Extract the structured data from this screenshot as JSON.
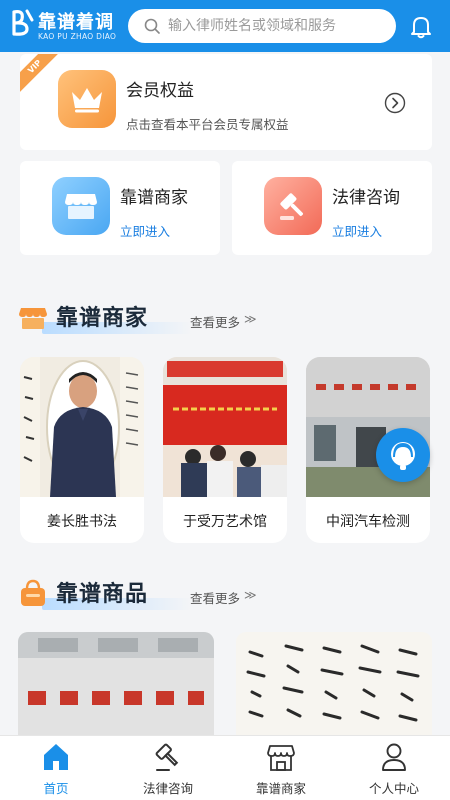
{
  "header": {
    "logo_cn": "靠谱着调",
    "logo_en": "KAO PU ZHAO DIAO",
    "search_placeholder": "输入律师姓名或领域和服务",
    "bell_icon": "bell-icon"
  },
  "member": {
    "ribbon": "VIP",
    "title": "会员权益",
    "subtitle": "点击查看本平台会员专属权益"
  },
  "services": [
    {
      "title": "靠谱商家",
      "link": "立即进入",
      "icon": "store-icon"
    },
    {
      "title": "法律咨询",
      "link": "立即进入",
      "icon": "gavel-icon"
    }
  ],
  "sections": {
    "merchants": {
      "title": "靠谱商家",
      "more": "查看更多"
    },
    "products": {
      "title": "靠谱商品",
      "more": "查看更多"
    }
  },
  "merchants": [
    {
      "name": "姜长胜书法"
    },
    {
      "name": "于受万艺术馆"
    },
    {
      "name": "中润汽车检测"
    }
  ],
  "tabbar": [
    {
      "label": "首页",
      "icon": "home-icon",
      "active": true
    },
    {
      "label": "法律咨询",
      "icon": "gavel-icon",
      "active": false
    },
    {
      "label": "靠谱商家",
      "icon": "store-icon",
      "active": false
    },
    {
      "label": "个人中心",
      "icon": "user-icon",
      "active": false
    }
  ],
  "colors": {
    "brand": "#1a8fe8",
    "accent_orange": "#f6953a",
    "accent_red": "#f26a57"
  }
}
